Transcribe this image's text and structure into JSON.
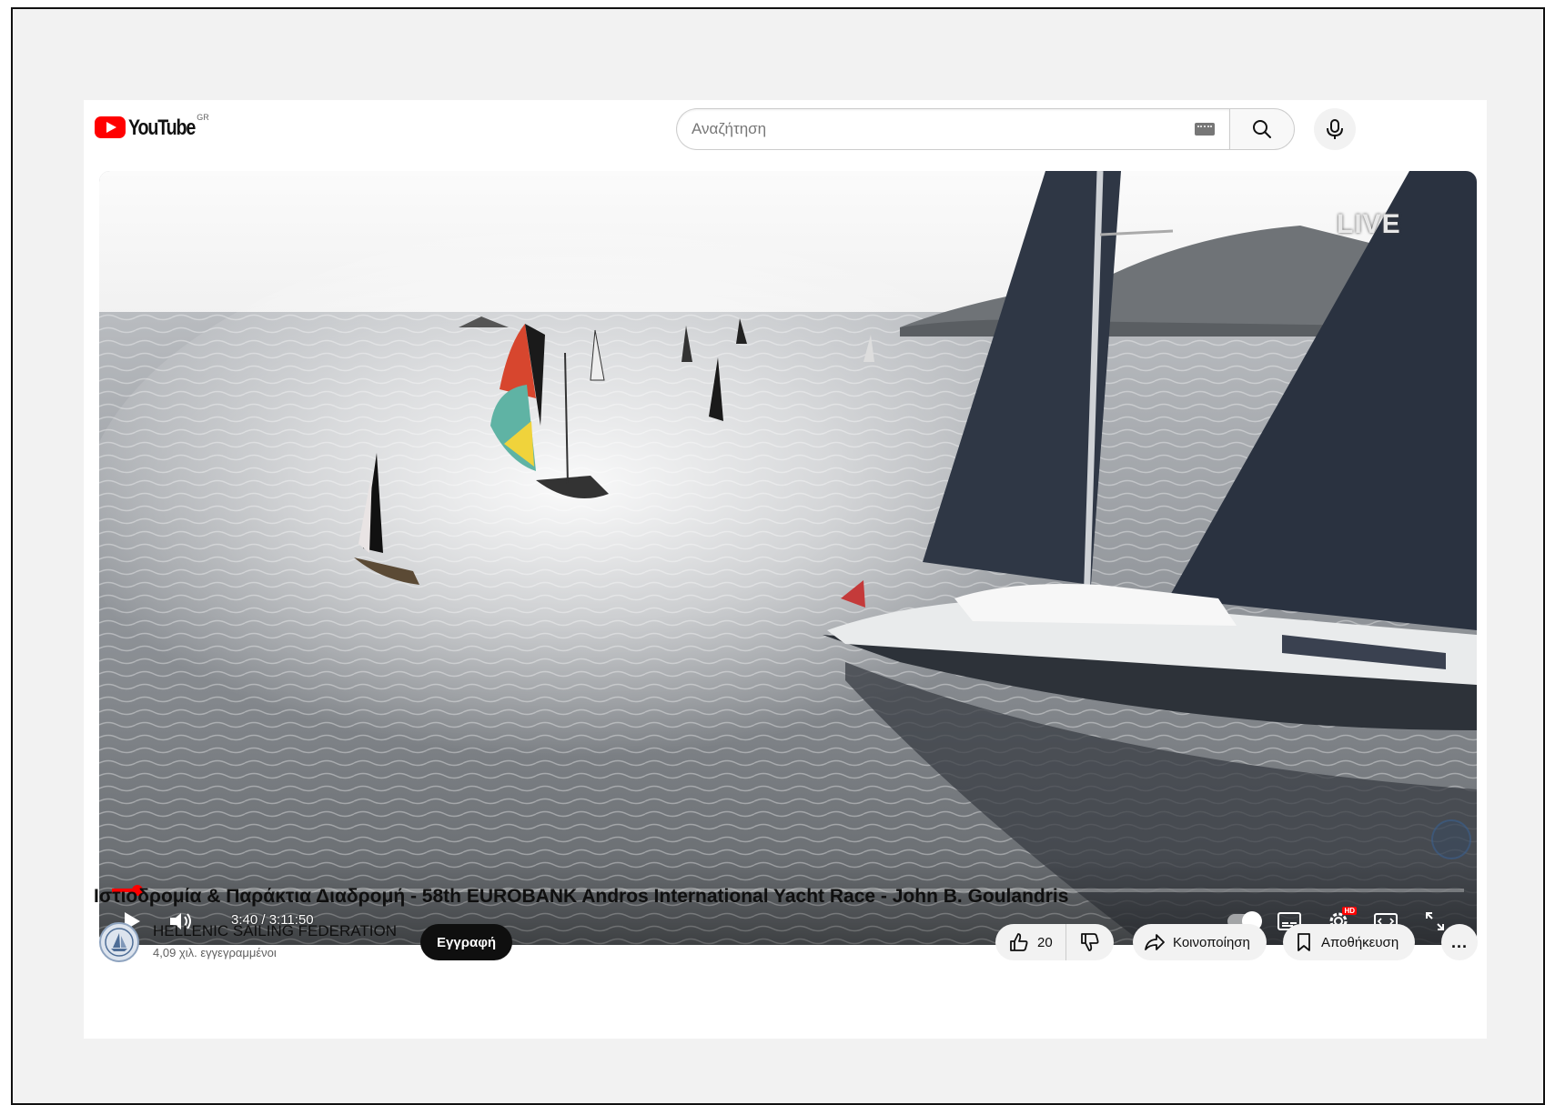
{
  "masthead": {
    "logo_text": "YouTube",
    "region": "GR",
    "search_placeholder": "Αναζήτηση"
  },
  "player": {
    "live_badge": "LIVE",
    "time_display": "3:40 / 3:11:50",
    "progress": 0.019
  },
  "video": {
    "title": "Ιστιοδρομία & Παράκτια Διαδρομή - 58th EUROBANK Andros International Yacht Race - John B. Goulandris"
  },
  "channel": {
    "name": "HELLENIC SAILING FEDERATION",
    "subscribers": "4,09 χιλ. εγγεγραμμένοι",
    "subscribe_label": "Εγγραφή"
  },
  "actions": {
    "like_count": "20",
    "share_label": "Κοινοποίηση",
    "save_label": "Αποθήκευση",
    "more_label": "..."
  },
  "colors": {
    "brand_red": "#ff0000",
    "text_primary": "#0f0f0f",
    "text_secondary": "#606060",
    "pill_bg": "#f2f2f2"
  }
}
